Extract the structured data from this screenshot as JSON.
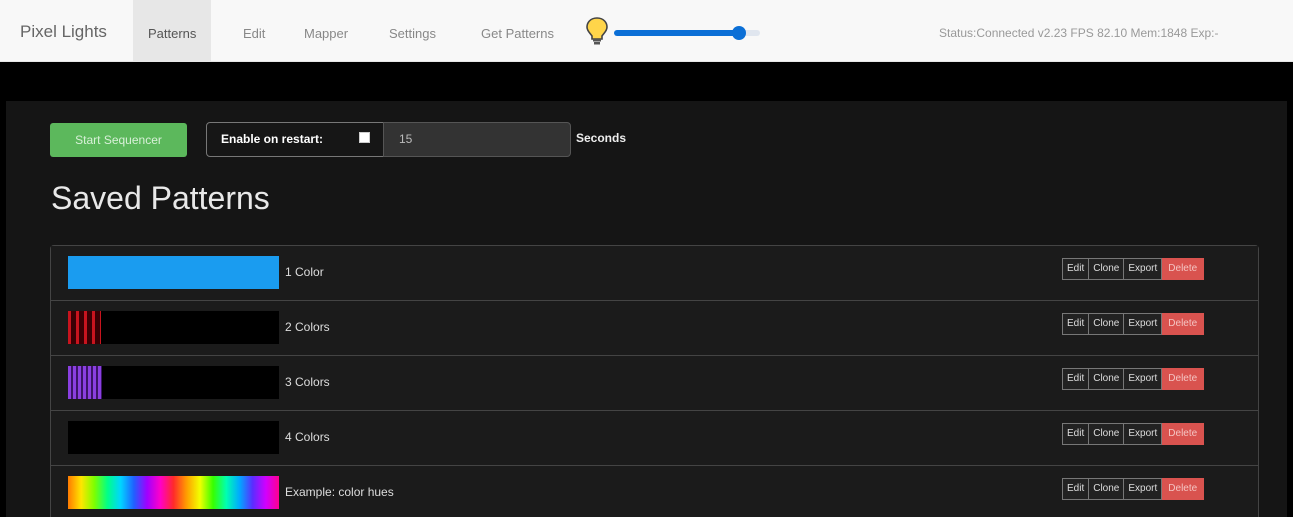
{
  "nav": {
    "brand": "Pixel Lights",
    "items": [
      "Patterns",
      "Edit",
      "Mapper",
      "Settings",
      "Get Patterns"
    ],
    "active_item": "Patterns",
    "brightness_icon": "lightbulb-icon",
    "brightness_level": 0.87,
    "status": "Status:Connected v2.23 FPS 82.10 Mem:1848 Exp:-"
  },
  "sequencer": {
    "start_label": "Start Sequencer",
    "restart_label": "Enable on restart:",
    "restart_checked": false,
    "seconds_value": "15",
    "seconds_label": "Seconds"
  },
  "title": "Saved Patterns",
  "actions": {
    "edit": "Edit",
    "clone": "Clone",
    "export": "Export",
    "delete": "Delete"
  },
  "patterns": [
    {
      "name": "1 Color",
      "preview": "solid-blue"
    },
    {
      "name": "2 Colors",
      "preview": "red-stripes"
    },
    {
      "name": "3 Colors",
      "preview": "purple-stripes"
    },
    {
      "name": "4 Colors",
      "preview": "black"
    },
    {
      "name": "Example: color hues",
      "preview": "rainbow-hues"
    }
  ],
  "colors": {
    "accent_blue": "#0b6fd6",
    "start_green": "#5cb85c",
    "delete_red": "#d9534f",
    "solid_blue": "#1a9cf0",
    "stripe_red": "#c8141e",
    "stripe_purple": "#8a3fe0"
  }
}
